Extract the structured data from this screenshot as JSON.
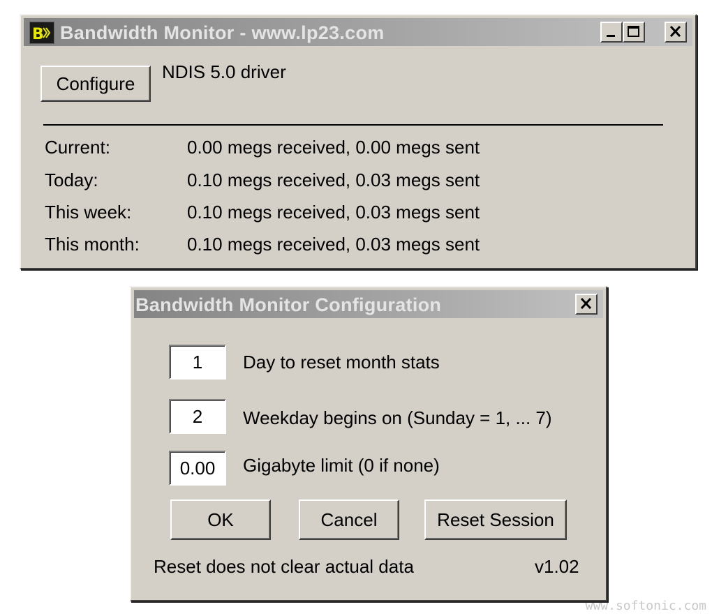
{
  "main_window": {
    "title": "Bandwidth Monitor - www.lp23.com",
    "configure_label": "Configure",
    "driver_text": "NDIS 5.0 driver",
    "stats": [
      {
        "label": "Current:",
        "value": "0.00 megs received, 0.00 megs sent"
      },
      {
        "label": "Today:",
        "value": "0.10 megs received, 0.03 megs sent"
      },
      {
        "label": "This week:",
        "value": "0.10 megs received, 0.03 megs sent"
      },
      {
        "label": "This month:",
        "value": "0.10 megs received, 0.03 megs sent"
      }
    ]
  },
  "config_dialog": {
    "title": "Bandwidth Monitor Configuration",
    "fields": [
      {
        "value": "1",
        "label": "Day to reset month stats"
      },
      {
        "value": "2",
        "label": "Weekday begins on (Sunday = 1, ... 7)"
      },
      {
        "value": "0.00",
        "label": "Gigabyte limit (0 if none)"
      }
    ],
    "ok_label": "OK",
    "cancel_label": "Cancel",
    "reset_label": "Reset Session",
    "note": "Reset does not clear actual data",
    "version": "v1.02"
  },
  "watermark": "www.softonic.com",
  "colors": {
    "window_bg": "#d4d0c8",
    "titlebar_inactive": "#a4a4a4",
    "title_text": "#e4e4e4"
  }
}
